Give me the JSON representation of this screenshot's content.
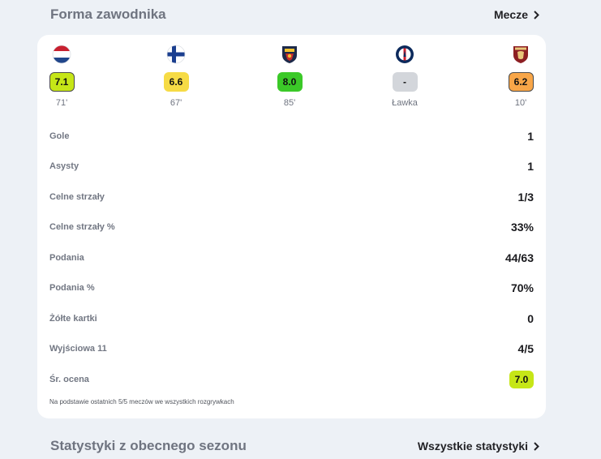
{
  "header": {
    "title": "Forma zawodnika",
    "link_label": "Mecze"
  },
  "matches": [
    {
      "crest": "netherlands-flag-icon",
      "rating": "7.1",
      "rating_color": "#c6e617",
      "minutes": "71'"
    },
    {
      "crest": "finland-flag-icon",
      "rating": "6.6",
      "rating_color": "#f6db45",
      "minutes": "67'"
    },
    {
      "crest": "lecce-crest-icon",
      "rating": "8.0",
      "rating_color": "#3bc928",
      "minutes": "85'"
    },
    {
      "crest": "psg-crest-icon",
      "rating": "-",
      "rating_color": "#d3d6db",
      "minutes": "Ławka"
    },
    {
      "crest": "torino-crest-icon",
      "rating": "6.2",
      "rating_color": "#f8a648",
      "minutes": "10'"
    }
  ],
  "stats": [
    {
      "label": "Gole",
      "value": "1"
    },
    {
      "label": "Asysty",
      "value": "1"
    },
    {
      "label": "Celne strzały",
      "value": "1/3"
    },
    {
      "label": "Celne strzały %",
      "value": "33%"
    },
    {
      "label": "Podania",
      "value": "44/63"
    },
    {
      "label": "Podania %",
      "value": "70%"
    },
    {
      "label": "Żółte kartki",
      "value": "0"
    },
    {
      "label": "Wyjściowa 11",
      "value": "4/5"
    },
    {
      "label": "Śr. ocena",
      "value": "7.0"
    }
  ],
  "footnote": "Na podstawie ostatnich 5/5 meczów we wszystkich rozgrywkach",
  "season": {
    "title": "Statystyki z obecnego sezonu",
    "link_label": "Wszystkie statystyki"
  }
}
